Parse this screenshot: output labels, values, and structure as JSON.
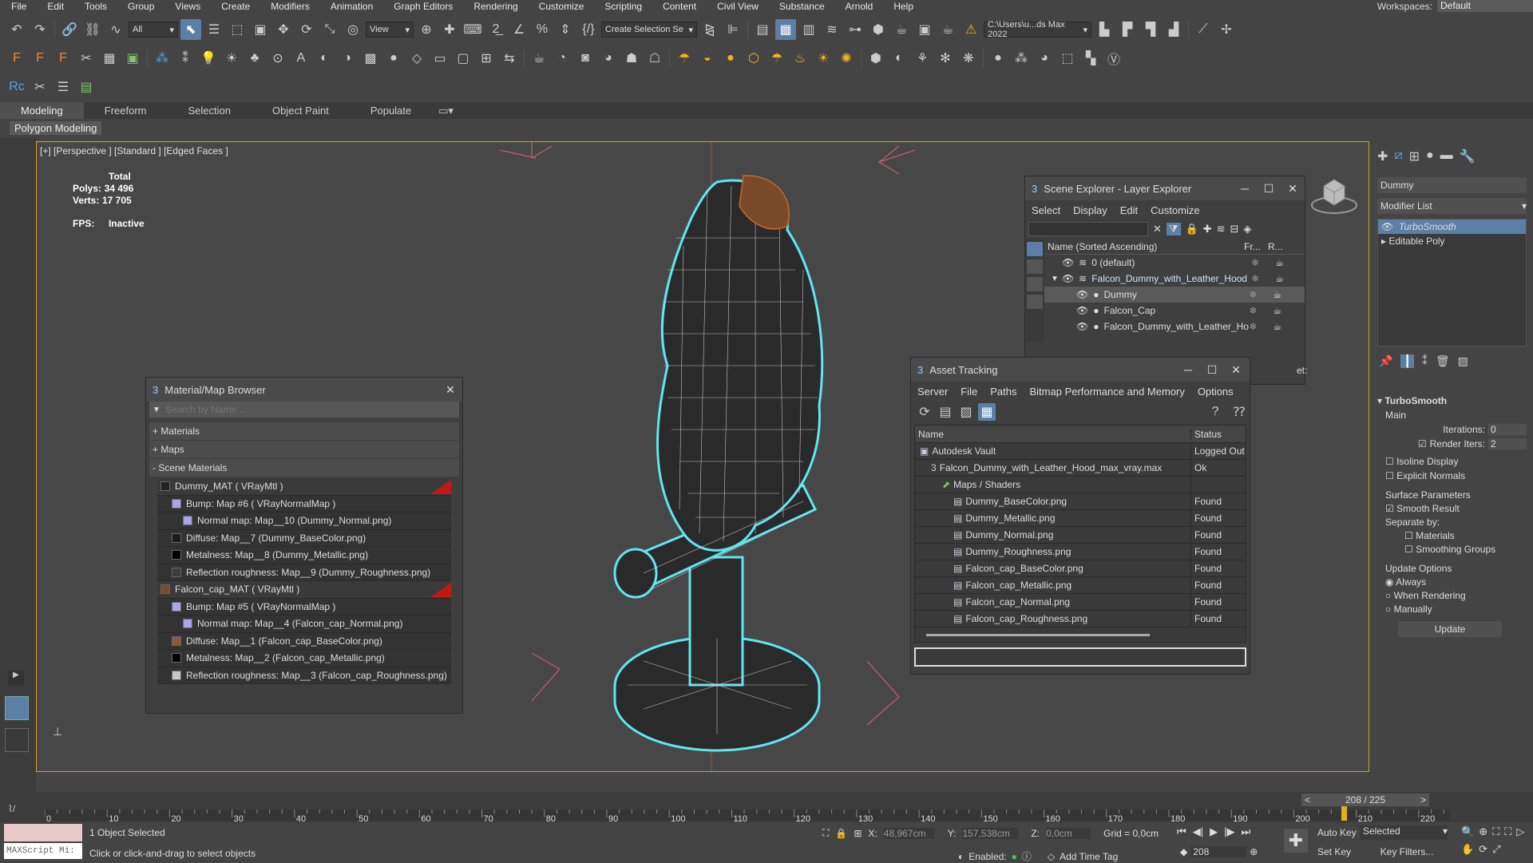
{
  "menubar": {
    "items": [
      "File",
      "Edit",
      "Tools",
      "Group",
      "Views",
      "Create",
      "Modifiers",
      "Animation",
      "Graph Editors",
      "Rendering",
      "Customize",
      "Scripting",
      "Content",
      "Civil View",
      "Substance",
      "Arnold",
      "Help"
    ],
    "workspaces_label": "Workspaces:",
    "workspace": "Default"
  },
  "toolbar": {
    "filter": "All",
    "view": "View",
    "selection_set": "Create Selection Se",
    "path": "C:\\Users\\u...ds Max 2022"
  },
  "ribbon": {
    "tabs": [
      "Modeling",
      "Freeform",
      "Selection",
      "Object Paint",
      "Populate"
    ],
    "active": "Modeling",
    "sub": "Polygon Modeling"
  },
  "viewport": {
    "label": "[+] [Perspective ] [Standard ] [Edged Faces ]",
    "total_label": "Total",
    "polys_label": "Polys:",
    "polys": "34 496",
    "verts_label": "Verts:",
    "verts": "17 705",
    "fps_label": "FPS:",
    "fps": "Inactive"
  },
  "material_browser": {
    "title": "Material/Map Browser",
    "search_placeholder": "Search by Name ...",
    "sections": [
      "+ Materials",
      "+ Maps",
      "- Scene Materials"
    ],
    "rows": [
      {
        "text": "Dummy_MAT  ( VRayMtl )",
        "level": 0,
        "swatch": "#222222",
        "red": true
      },
      {
        "text": "Bump: Map #6  ( VRayNormalMap )",
        "level": 1,
        "swatch": "#aaa6e8"
      },
      {
        "text": "Normal map: Map__10 (Dummy_Normal.png)",
        "level": 2,
        "swatch": "#a9a4f0"
      },
      {
        "text": "Diffuse: Map__7 (Dummy_BaseColor.png)",
        "level": 1,
        "swatch": "#1b1b1b"
      },
      {
        "text": "Metalness: Map__8 (Dummy_Metallic.png)",
        "level": 1,
        "swatch": "#000000"
      },
      {
        "text": "Reflection roughness: Map__9 (Dummy_Roughness.png)",
        "level": 1,
        "swatch": "#3d3d3d"
      },
      {
        "text": "Falcon_cap_MAT  ( VRayMtl )",
        "level": 0,
        "swatch": "#7a4a2a",
        "red": true
      },
      {
        "text": "Bump: Map #5  ( VRayNormalMap )",
        "level": 1,
        "swatch": "#aaa6e8"
      },
      {
        "text": "Normal map: Map__4 (Falcon_cap_Normal.png)",
        "level": 2,
        "swatch": "#a9a4f0"
      },
      {
        "text": "Diffuse: Map__1 (Falcon_cap_BaseColor.png)",
        "level": 1,
        "swatch": "#8a5a3a"
      },
      {
        "text": "Metalness: Map__2 (Falcon_cap_Metallic.png)",
        "level": 1,
        "swatch": "#000000"
      },
      {
        "text": "Reflection roughness: Map__3 (Falcon_cap_Roughness.png)",
        "level": 1,
        "swatch": "#c8c8c8"
      }
    ]
  },
  "scene_explorer": {
    "title": "Scene Explorer - Layer Explorer",
    "menu": [
      "Select",
      "Display",
      "Edit",
      "Customize"
    ],
    "col_name": "Name (Sorted Ascending)",
    "col_fr": "Fr...",
    "col_r": "R...",
    "rows": [
      {
        "text": "0 (default)",
        "level": 0,
        "sel": false
      },
      {
        "text": "Falcon_Dummy_with_Leather_Hood",
        "level": 0,
        "sel": false,
        "expanded": true,
        "blue": true
      },
      {
        "text": "Dummy",
        "level": 1,
        "sel": true
      },
      {
        "text": "Falcon_Cap",
        "level": 1,
        "sel": false
      },
      {
        "text": "Falcon_Dummy_with_Leather_Hood",
        "level": 1,
        "sel": false
      }
    ],
    "peek_text": "et:"
  },
  "asset_tracking": {
    "title": "Asset Tracking",
    "menu": [
      "Server",
      "File",
      "Paths",
      "Bitmap Performance and Memory",
      "Options"
    ],
    "col_name": "Name",
    "col_status": "Status",
    "rows": [
      {
        "name": "Autodesk Vault",
        "status": "Logged Out",
        "level": 0
      },
      {
        "name": "Falcon_Dummy_with_Leather_Hood_max_vray.max",
        "status": "Ok",
        "level": 1
      },
      {
        "name": "Maps / Shaders",
        "status": "",
        "level": 2
      },
      {
        "name": "Dummy_BaseColor.png",
        "status": "Found",
        "level": 3
      },
      {
        "name": "Dummy_Metallic.png",
        "status": "Found",
        "level": 3
      },
      {
        "name": "Dummy_Normal.png",
        "status": "Found",
        "level": 3
      },
      {
        "name": "Dummy_Roughness.png",
        "status": "Found",
        "level": 3
      },
      {
        "name": "Falcon_cap_BaseColor.png",
        "status": "Found",
        "level": 3
      },
      {
        "name": "Falcon_cap_Metallic.png",
        "status": "Found",
        "level": 3
      },
      {
        "name": "Falcon_cap_Normal.png",
        "status": "Found",
        "level": 3
      },
      {
        "name": "Falcon_cap_Roughness.png",
        "status": "Found",
        "level": 3
      }
    ]
  },
  "command_panel": {
    "object_name": "Dummy",
    "modifier_list": "Modifier List",
    "stack": [
      "TurboSmooth",
      "Editable Poly"
    ],
    "turbosmooth": {
      "title": "TurboSmooth",
      "main": "Main",
      "iterations_label": "Iterations:",
      "iterations": "0",
      "render_iters_label": "Render Iters:",
      "render_iters": "2",
      "isoline": "Isoline Display",
      "explicit": "Explicit Normals",
      "surface": "Surface Parameters",
      "smooth_result": "Smooth Result",
      "separate": "Separate by:",
      "materials": "Materials",
      "smoothing": "Smoothing Groups",
      "update_options": "Update Options",
      "always": "Always",
      "when_rendering": "When Rendering",
      "manually": "Manually",
      "update_btn": "Update"
    }
  },
  "timeline": {
    "frame": "208 / 225",
    "current": 208,
    "max": 225,
    "ticks": [
      0,
      10,
      20,
      30,
      40,
      50,
      60,
      70,
      80,
      90,
      100,
      110,
      120,
      130,
      140,
      150,
      160,
      170,
      180,
      190,
      200,
      210,
      220
    ]
  },
  "status": {
    "maxscript": "MAXScript Mi:",
    "selected": "1 Object Selected",
    "hint": "Click or click-and-drag to select objects",
    "x_label": "X:",
    "x": "48,967cm",
    "y_label": "Y:",
    "y": "157,538cm",
    "z_label": "Z:",
    "z": "0,0cm",
    "grid": "Grid = 0,0cm",
    "enabled": "Enabled:",
    "add_time_tag": "Add Time Tag",
    "frame_field": "208",
    "auto_key": "Auto Key",
    "selected_dd": "Selected",
    "set_key": "Set Key",
    "key_filters": "Key Filters..."
  },
  "colors": {
    "accent": "#5b7fa6",
    "selection_outline": "#5fe6f0",
    "viewport_border": "#d4a02a"
  }
}
